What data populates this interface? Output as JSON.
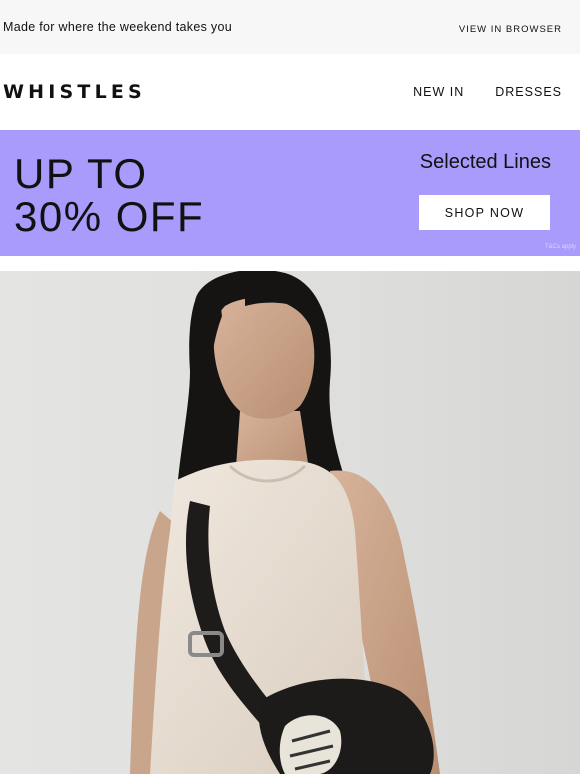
{
  "preheader": {
    "text": "Made for where the weekend takes you",
    "view_in_browser": "VIEW IN BROWSER"
  },
  "header": {
    "logo": "WHISTLES",
    "nav": [
      {
        "label": "NEW IN"
      },
      {
        "label": "DRESSES"
      }
    ]
  },
  "banner": {
    "headline_line1": "UP TO",
    "headline_line2": "30% OFF",
    "subheading": "Selected Lines",
    "cta": "SHOP NOW",
    "terms": "T&Cs apply",
    "background": "#a89bfb"
  },
  "hero": {
    "alt_icon": "model-photo",
    "background": "#e1e1df"
  }
}
